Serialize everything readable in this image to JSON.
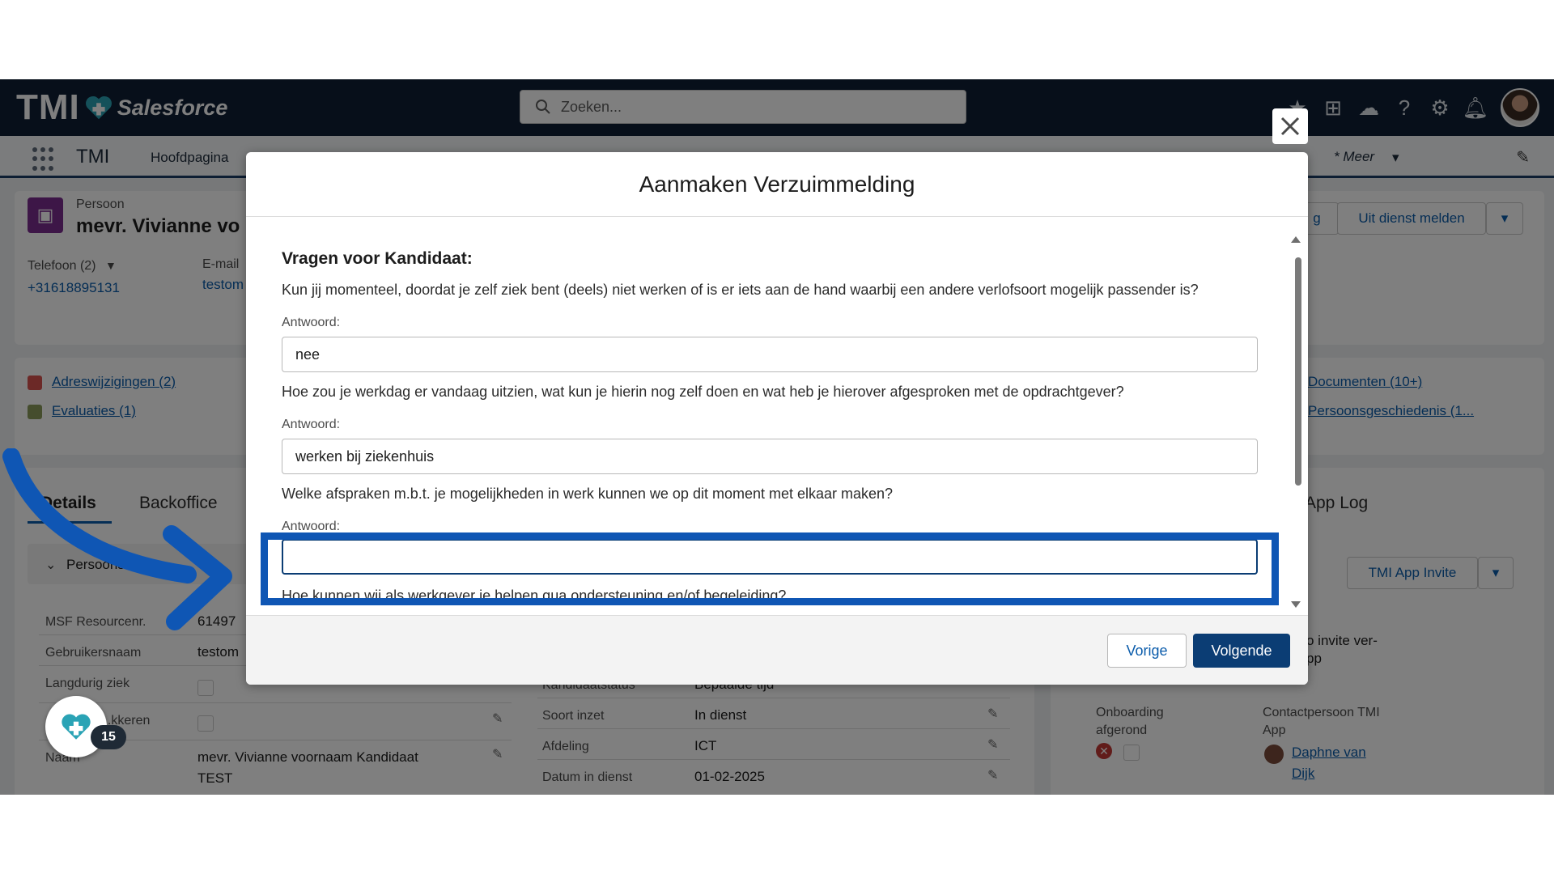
{
  "header": {
    "logo_tmi": "TMI",
    "logo_salesforce": "Salesforce",
    "search_placeholder": "Zoeken..."
  },
  "nav": {
    "app_name": "TMI",
    "home": "Hoofdpagina",
    "more": "* Meer"
  },
  "record": {
    "type": "Persoon",
    "name": "mevr. Vivianne vo",
    "phone_label": "Telefoon (2)",
    "phone": "+31618895131",
    "email_label": "E-mail",
    "email": "testom",
    "btn_partial": "g",
    "btn_uit_dienst": "Uit dienst melden"
  },
  "related": {
    "adres": "Adreswijzigingen (2)",
    "evaluaties": "Evaluaties (1)",
    "documenten": "Documenten (10+)",
    "geschiedenis": "Persoonsgeschiedenis (1..."
  },
  "tabs": {
    "details": "Details",
    "backoffice": "Backoffice",
    "app_log": "App Log"
  },
  "details": {
    "section": "Persoonsinfo",
    "msf_label": "MSF Resourcenr.",
    "msf_value": "61497",
    "user_label": "Gebruikersnaam",
    "user_value": "testom",
    "ziek_label": "Langdurig ziek",
    "check_label": "...kkeren",
    "naam_label": "Naam",
    "naam_value_1": "mevr. Vivianne voornaam Kandidaat",
    "naam_value_2": "TEST",
    "kstatus_label": "Kandidaatstatus",
    "kstatus_value": "Bepaalde tijd",
    "inzet_label": "Soort inzet",
    "inzet_value": "In dienst",
    "afdeling_label": "Afdeling",
    "afdeling_value": "ICT",
    "datum_label": "Datum in dienst",
    "datum_value": "01-02-2025"
  },
  "right_panel": {
    "invite_btn": "TMI App Invite",
    "invite_text_1": "o invite ver-",
    "invite_text_2": "pp",
    "onboarding_label_1": "Onboarding",
    "onboarding_label_2": "afgerond",
    "contact_label_1": "Contactpersoon TMI",
    "contact_label_2": "App",
    "contact_name_1": "Daphne van",
    "contact_name_2": "Dijk"
  },
  "modal": {
    "title": "Aanmaken Verzuimmelding",
    "section_heading": "Vragen voor Kandidaat:",
    "q1": "Kun jij momenteel, doordat je zelf ziek bent (deels) niet werken of is er iets aan de hand waarbij een andere verlofsoort mogelijk passender is?",
    "answer_label": "Antwoord:",
    "a1": "nee",
    "q2": "Hoe zou je werkdag er vandaag uitzien, wat kun je hierin nog zelf doen en wat heb je hierover afgesproken met de opdrachtgever?",
    "a2": "werken bij ziekenhuis",
    "q3": "Welke afspraken m.b.t. je mogelijkheden in werk kunnen we op dit moment met elkaar maken?",
    "a3": "",
    "q4": "Hoe kunnen wij als werkgever je helpen qua ondersteuning en/of begeleiding?",
    "btn_prev": "Vorige",
    "btn_next": "Volgende"
  },
  "fab": {
    "badge": "15"
  },
  "colors": {
    "header_bg": "#0e1f35",
    "accent": "#0b3d74",
    "highlight": "#0f56b4",
    "link": "#0b5cab"
  }
}
